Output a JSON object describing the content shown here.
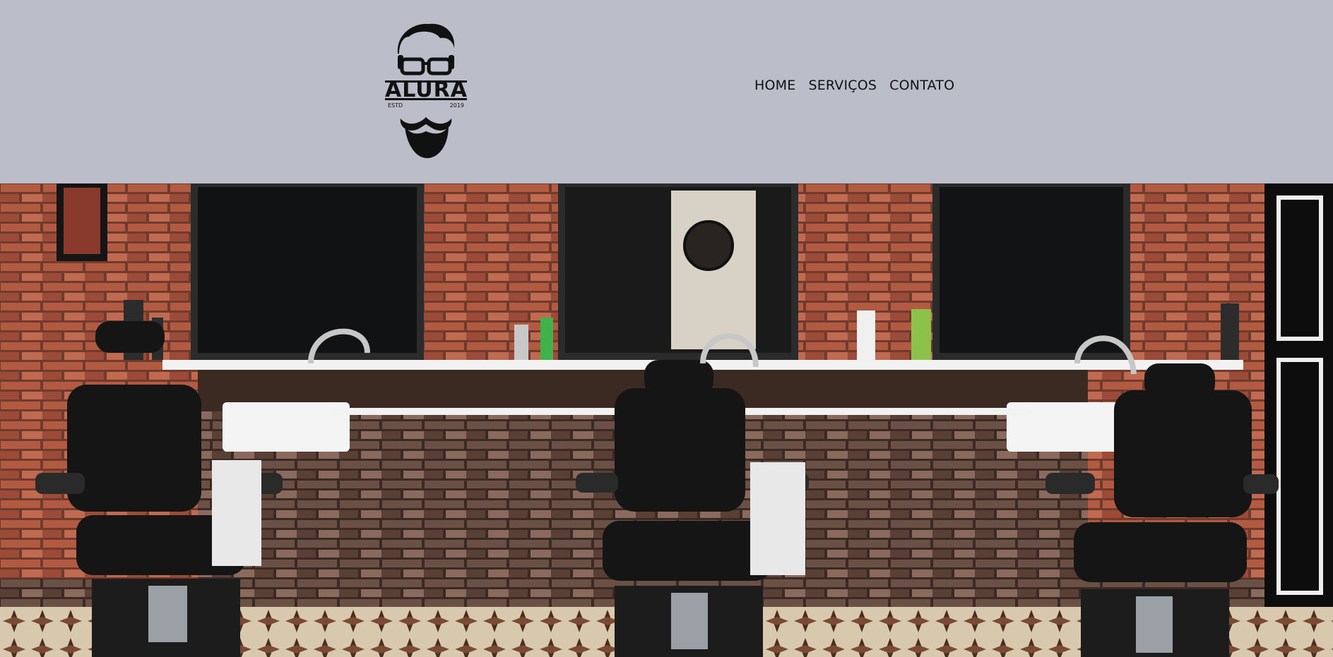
{
  "logo": {
    "wordmark": "ALURA",
    "estd": "ESTD",
    "year": "2019"
  },
  "nav": {
    "items": [
      {
        "label": "HOME"
      },
      {
        "label": "SERVIÇOS"
      },
      {
        "label": "CONTATO"
      }
    ]
  },
  "hero": {
    "image_subject": "barbershop-interior"
  },
  "colors": {
    "header_bg": "#bbbec9",
    "text": "#111111"
  }
}
